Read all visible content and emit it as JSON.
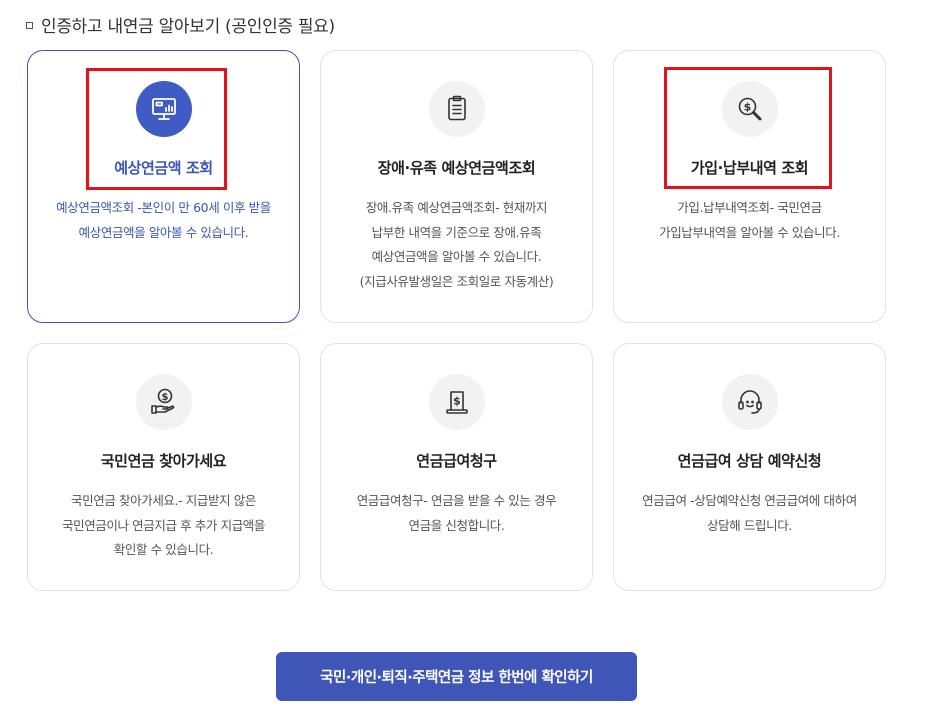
{
  "section": {
    "title": "인증하고 내연금 알아보기 (공인인증 필요)"
  },
  "cards": [
    {
      "title": "예상연금액 조회",
      "desc": "예상연금액조회 -본인이 만 60세 이후 받을\n예상연금액을 알아볼 수 있습니다.",
      "icon": "monitor-chart-icon",
      "active": true
    },
    {
      "title": "장애·유족 예상연금액조회",
      "desc": "장애.유족 예상연금액조회- 현재까지\n납부한 내역을 기준으로 장애.유족\n예상연금액을 알아볼 수 있습니다.\n(지급사유발생일은 조회일로 자동계산)",
      "icon": "clipboard-list-icon",
      "active": false
    },
    {
      "title": "가입·납부내역 조회",
      "desc": "가입.납부내역조회- 국민연금\n가입납부내역을 알아볼 수 있습니다.",
      "icon": "magnifier-dollar-icon",
      "active": false
    },
    {
      "title": "국민연금 찾아가세요",
      "desc": "국민연금 찾아가세요.- 지급받지 않은\n국민연금이나 연금지급 후 추가 지급액을\n확인할 수 있습니다.",
      "icon": "hand-coin-icon",
      "active": false
    },
    {
      "title": "연금급여청구",
      "desc": "연금급여청구- 연금을 받을 수 있는 경우\n연금을 신청합니다.",
      "icon": "document-dollar-icon",
      "active": false
    },
    {
      "title": "연금급여 상담 예약신청",
      "desc": "연금급여 -상담예약신청 연금급여에 대하여\n상담해 드립니다.",
      "icon": "headset-icon",
      "active": false
    }
  ],
  "cta": {
    "label": "국민·개인·퇴직·주택연금 정보 한번에 확인하기"
  },
  "colors": {
    "accent": "#3f5cc4",
    "highlight": "#e3131b",
    "button": "#3f55b8"
  }
}
